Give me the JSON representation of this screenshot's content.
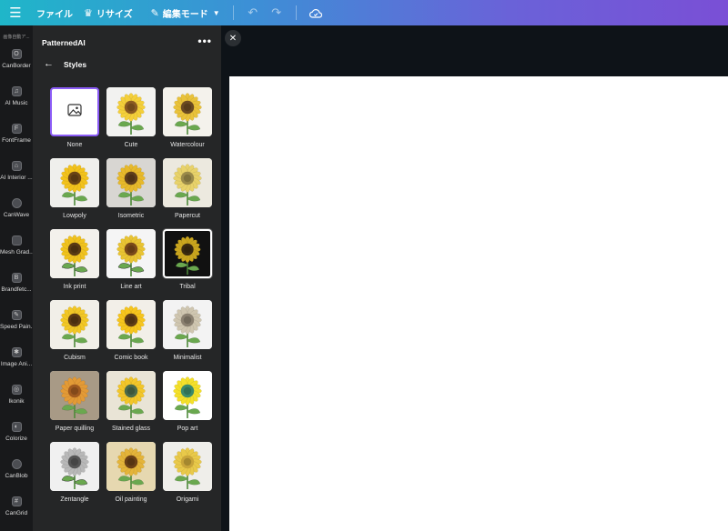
{
  "topbar": {
    "menu_icon": "hamburger-icon",
    "file": "ファイル",
    "resize": "リサイズ",
    "mode": "編集モード",
    "undo_icon": "undo-icon",
    "redo_icon": "redo-icon",
    "cloud_icon": "cloud-sync-icon"
  },
  "rail": {
    "top_label": "画像自動ア...",
    "items": [
      {
        "label": "CanBorder",
        "icon": "O"
      },
      {
        "label": "AI Music",
        "icon": "♫"
      },
      {
        "label": "FontFrame",
        "icon": "F"
      },
      {
        "label": "AI Interior ...",
        "icon": "⌂"
      },
      {
        "label": "CanWave",
        "icon": ""
      },
      {
        "label": "Mesh Grad...",
        "icon": ""
      },
      {
        "label": "Brandfetc...",
        "icon": "B"
      },
      {
        "label": "Speed Pain...",
        "icon": "✎"
      },
      {
        "label": "Image Ani...",
        "icon": "✱"
      },
      {
        "label": "Ikonik",
        "icon": "◎"
      },
      {
        "label": "Colorize",
        "icon": "◐"
      },
      {
        "label": "CanBlob",
        "icon": ""
      },
      {
        "label": "CanGrid",
        "icon": "#"
      }
    ]
  },
  "panel": {
    "app_name": "PatternedAI",
    "more_icon": "more-icon",
    "back_icon": "back-arrow-icon",
    "title": "Styles",
    "styles": [
      {
        "label": "None"
      },
      {
        "label": "Cute"
      },
      {
        "label": "Watercolour"
      },
      {
        "label": "Lowpoly"
      },
      {
        "label": "Isometric"
      },
      {
        "label": "Papercut"
      },
      {
        "label": "Ink print"
      },
      {
        "label": "Line art"
      },
      {
        "label": "Tribal"
      },
      {
        "label": "Cubism"
      },
      {
        "label": "Comic book"
      },
      {
        "label": "Minimalist"
      },
      {
        "label": "Paper quilling"
      },
      {
        "label": "Stained glass"
      },
      {
        "label": "Pop art"
      },
      {
        "label": "Zentangle"
      },
      {
        "label": "Oil painting"
      },
      {
        "label": "Origami"
      }
    ]
  },
  "canvas": {
    "close_icon": "close-icon"
  },
  "colors": {
    "accent": "#8b5cf6",
    "panel_bg": "#252627",
    "rail_bg": "#18191b",
    "canvas_bg": "#0e1318"
  }
}
